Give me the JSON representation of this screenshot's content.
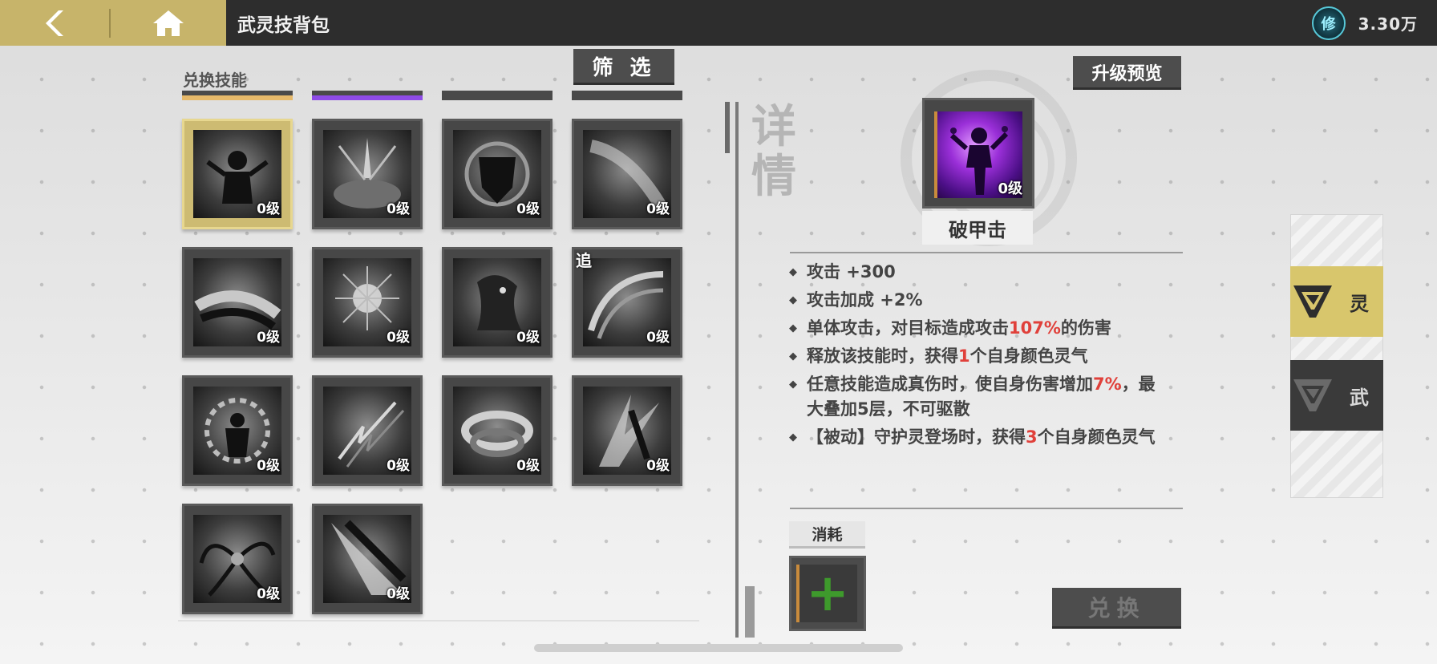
{
  "header": {
    "title": "武灵技背包",
    "currency_icon_glyph": "修",
    "currency_value": "3.30万"
  },
  "left_panel": {
    "section_label": "兑换技能",
    "filter_label": "筛 选",
    "skills": [
      {
        "level": "0级",
        "selected": true,
        "tag": ""
      },
      {
        "level": "0级",
        "selected": false,
        "tag": ""
      },
      {
        "level": "0级",
        "selected": false,
        "tag": ""
      },
      {
        "level": "0级",
        "selected": false,
        "tag": ""
      },
      {
        "level": "0级",
        "selected": false,
        "tag": ""
      },
      {
        "level": "0级",
        "selected": false,
        "tag": ""
      },
      {
        "level": "0级",
        "selected": false,
        "tag": ""
      },
      {
        "level": "0级",
        "selected": false,
        "tag": "追"
      },
      {
        "level": "0级",
        "selected": false,
        "tag": ""
      },
      {
        "level": "0级",
        "selected": false,
        "tag": ""
      },
      {
        "level": "0级",
        "selected": false,
        "tag": ""
      },
      {
        "level": "0级",
        "selected": false,
        "tag": ""
      },
      {
        "level": "0级",
        "selected": false,
        "tag": ""
      },
      {
        "level": "0级",
        "selected": false,
        "tag": ""
      }
    ]
  },
  "details": {
    "vertical_label": "详情",
    "upgrade_preview_label": "升级预览",
    "skill_level": "0级",
    "skill_name": "破甲击",
    "cost_label": "消耗",
    "exchange_label": "兑换"
  },
  "side_tabs": [
    {
      "label": "灵",
      "active": true
    },
    {
      "label": "武",
      "active": false
    }
  ],
  "colors": {
    "gold_accent": "#c7b46a",
    "highlight_red": "#e0403a",
    "plus_green": "#3e9a2c",
    "cyan_currency": "#57c8d8",
    "skill_purple": "#9a2fd8"
  }
}
